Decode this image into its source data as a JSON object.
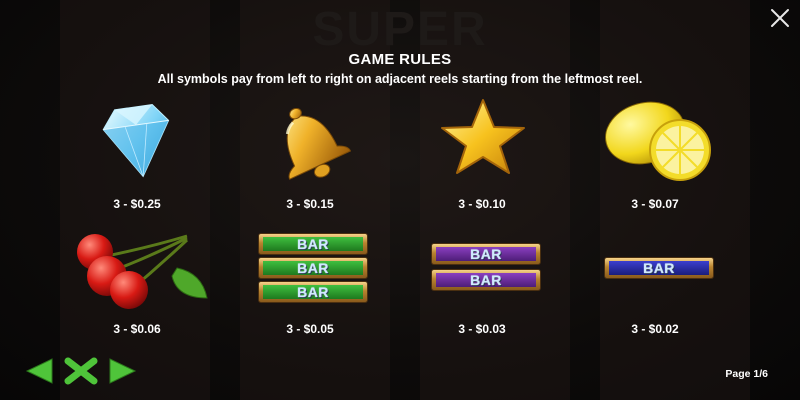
{
  "header": {
    "title": "GAME RULES",
    "subtitle": "All symbols pay from left to right on adjacent reels starting from the leftmost reel.",
    "background_logo": "SUPER"
  },
  "symbols": [
    {
      "name": "diamond",
      "icon": "diamond-icon",
      "payout": "3 - $0.25"
    },
    {
      "name": "bell",
      "icon": "bell-icon",
      "payout": "3 - $0.15"
    },
    {
      "name": "star",
      "icon": "star-icon",
      "payout": "3 - $0.10"
    },
    {
      "name": "lemon",
      "icon": "lemon-icon",
      "payout": "3 - $0.07"
    },
    {
      "name": "cherries",
      "icon": "cherries-icon",
      "payout": "3 - $0.06"
    },
    {
      "name": "triple-bar",
      "icon": "triple-bar-icon",
      "payout": "3 - $0.05",
      "label": "BAR"
    },
    {
      "name": "double-bar",
      "icon": "double-bar-icon",
      "payout": "3 - $0.03",
      "label": "BAR"
    },
    {
      "name": "single-bar",
      "icon": "single-bar-icon",
      "payout": "3 - $0.02",
      "label": "BAR"
    }
  ],
  "navigation": {
    "page_indicator": "Page 1/6",
    "prev_icon": "arrow-left-icon",
    "close_icon": "x-close-icon",
    "next_icon": "arrow-right-icon"
  },
  "colors": {
    "nav_green": "#4fc43a",
    "text": "#ffffff",
    "background": "#0b0a0a"
  }
}
